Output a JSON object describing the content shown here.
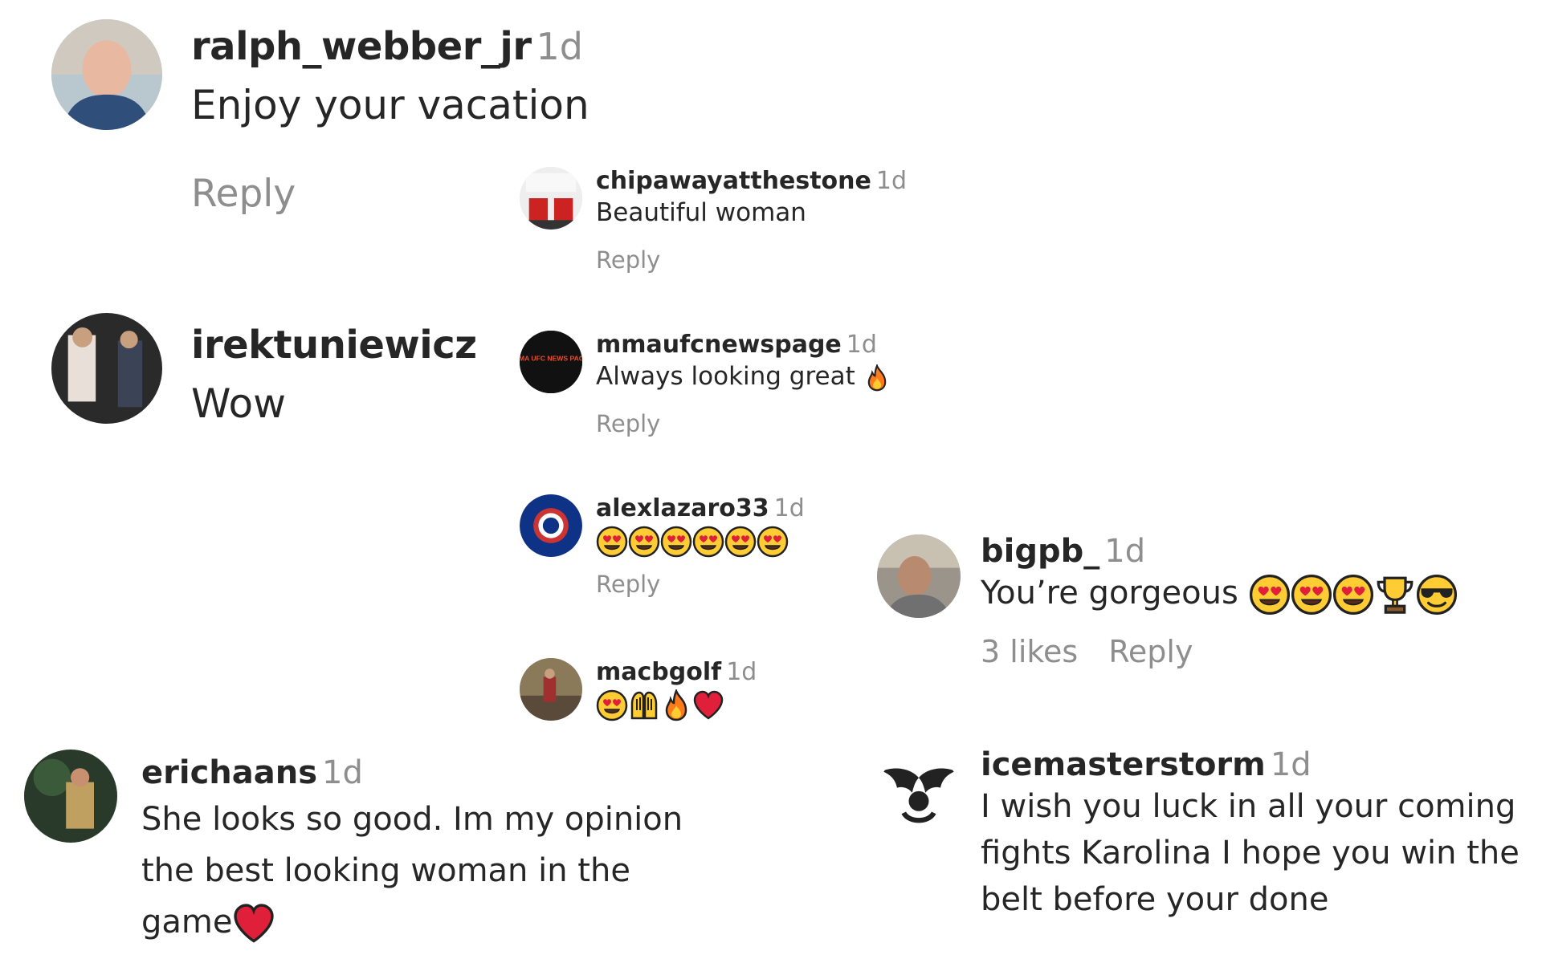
{
  "comments": {
    "ralph": {
      "user": "ralph_webber_jr",
      "time": "1d",
      "text": "Enjoy your vacation",
      "reply": "Reply"
    },
    "irek": {
      "user": "irektuniewicz",
      "text": "Wow"
    },
    "chip": {
      "user": "chipawayatthestone",
      "time": "1d",
      "text": "Beautiful woman",
      "reply": "Reply"
    },
    "mma": {
      "user": "mmaufcnewspage",
      "time": "1d",
      "text": "Always looking great",
      "reply": "Reply"
    },
    "alex": {
      "user": "alexlazaro33",
      "time": "1d",
      "reply": "Reply"
    },
    "mac": {
      "user": "macbgolf",
      "time": "1d"
    },
    "bigpb": {
      "user": "bigpb_",
      "time": "1d",
      "text": "You’re gorgeous",
      "likes": "3 likes",
      "reply": "Reply"
    },
    "eric": {
      "user": "erichaans",
      "time": "1d",
      "text_lines": [
        "She looks so good. Im my opinion",
        "the best looking woman in the",
        "game"
      ]
    },
    "ice": {
      "user": "icemasterstorm",
      "time": "1d",
      "text_lines": [
        "I wish you luck in all your coming",
        "fights Karolina I hope you win the",
        "belt before your done"
      ]
    }
  },
  "avatar_labels": {
    "mma": "MMA UFC NEWS PAGE"
  },
  "emoji_names": {
    "alex": [
      "heart-eyes",
      "heart-eyes",
      "heart-eyes",
      "heart-eyes",
      "heart-eyes",
      "heart-eyes"
    ],
    "mac": [
      "heart-eyes",
      "raising-hands",
      "fire",
      "red-heart"
    ],
    "bigpb": [
      "heart-eyes",
      "heart-eyes",
      "heart-eyes",
      "trophy",
      "sunglasses-face"
    ],
    "mma": [
      "fire"
    ],
    "eric": [
      "red-heart"
    ]
  },
  "colors": {
    "text": "#262626",
    "muted": "#8e8e8e",
    "heart": "#e0203a",
    "emoji_yellow": "#ffcc33",
    "fire": "#ff7a1a"
  }
}
